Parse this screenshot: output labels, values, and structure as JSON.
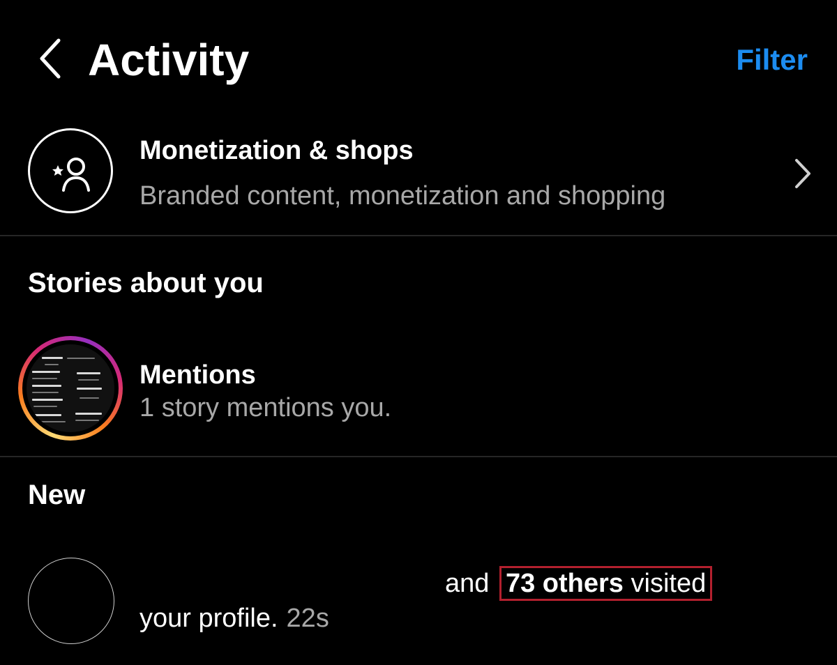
{
  "header": {
    "title": "Activity",
    "filter_label": "Filter"
  },
  "monetization": {
    "title": "Monetization & shops",
    "subtitle": "Branded content, monetization and shopping"
  },
  "stories_section": {
    "heading": "Stories about you",
    "mentions": {
      "title": "Mentions",
      "subtitle": "1 story mentions you."
    }
  },
  "new_section": {
    "heading": "New",
    "notification": {
      "prefix": "and",
      "count_label": "73 others",
      "action": "visited",
      "line2": "your profile.",
      "time": "22s"
    }
  },
  "colors": {
    "background": "#000000",
    "accent_link": "#1c8cf0",
    "secondary_text": "#a8a8a8",
    "highlight_box": "#b3202e"
  },
  "icons": {
    "back": "chevron-left-icon",
    "monetization": "star-person-icon",
    "row_chevron": "chevron-right-icon"
  }
}
